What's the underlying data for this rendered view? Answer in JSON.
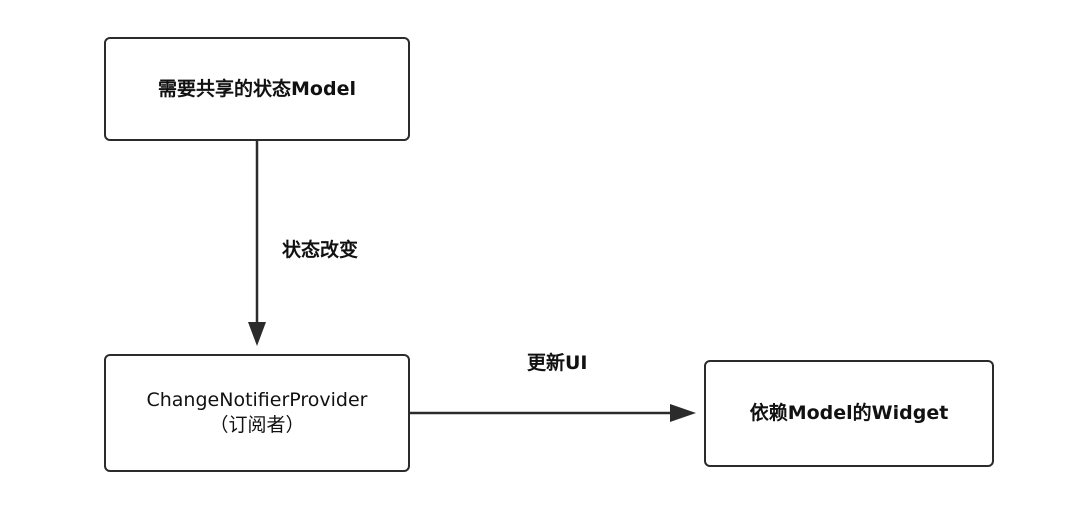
{
  "nodes": {
    "state_model": "需要共享的状态Model",
    "provider_line1": "ChangeNotifierProvider",
    "provider_line2": "（订阅者）",
    "widget": "依赖Model的Widget"
  },
  "edges": {
    "state_change": "状态改变",
    "update_ui": "更新UI"
  },
  "colors": {
    "stroke": "#2b2b2b",
    "background": "#ffffff"
  }
}
